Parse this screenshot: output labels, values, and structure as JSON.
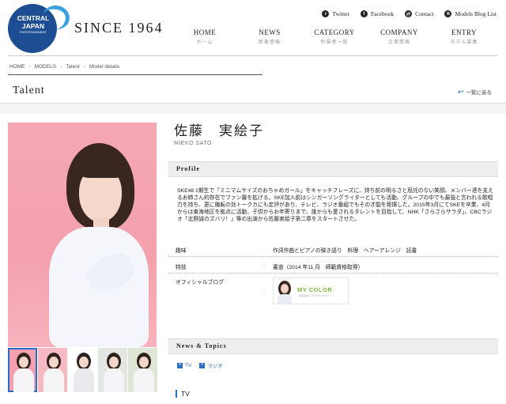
{
  "brand": {
    "logo_line1": "CENTRAL",
    "logo_line2": "JAPAN",
    "logo_line3": "ENTERTAINMENT",
    "tagline": "SINCE 1964",
    "accent": "#1d4e93"
  },
  "top_links": [
    {
      "icon": "t",
      "label": "Twitter"
    },
    {
      "icon": "f",
      "label": "Facebook"
    },
    {
      "icon": "@",
      "label": "Contact"
    },
    {
      "icon": "B",
      "label": "Models Blog List"
    }
  ],
  "nav": [
    {
      "en": "HOME",
      "jp": "ホーム"
    },
    {
      "en": "NEWS",
      "jp": "新着情報"
    },
    {
      "en": "CATEGORY",
      "jp": "所属者一覧"
    },
    {
      "en": "COMPANY",
      "jp": "企業情報"
    },
    {
      "en": "ENTRY",
      "jp": "モデル募集"
    }
  ],
  "breadcrumb": [
    "HOME",
    "MODELS",
    "Talent",
    "Model details"
  ],
  "breadcrumb_sep": "›",
  "page_title": "Talent",
  "back_link": "一覧に戻る",
  "talent": {
    "name_jp": "佐藤　実絵子",
    "name_en": "MIEKO SATO"
  },
  "profile": {
    "heading": "Profile",
    "text": "SKE48 1期生で「ミニマムサイズのおちゃめガール」をキャッチフレーズに、持ち前の明るさと屈託のない笑顔、メンバー達を支えるお姉さん的存在でファン層を拡げる。SKE加入前はシンガーソングライターとしても活動、グループの中でも最強と言われる歌唱力を持ち、更に機転の効トークカにも定評があり、テレビ、ラジオ番組でもその才能を発揮した。2015年3月にてSKEを卒業、4月からは東海地区を拠点に活動、子供からお年寄りまで、誰からも愛されるタレントを目指して、NHK「さらさらサラダ」、CBCラジオ「北野誠のズバリ！」等の出演から佐藤実絵子第二章をスタートさせた。",
    "hobby_label": "趣味",
    "hobby_value": "作詞作曲とピアノの弾き語り　料理　ヘアーアレンジ　読書",
    "skill_label": "特技",
    "skill_value": "書道（2014 年11 月　師範資格取得）",
    "blog_label": "オフィシャルブログ",
    "blog_logo": "MY COLOR",
    "blog_sub": "佐藤実絵子 OFFICIAL BLOG",
    "colon": ":"
  },
  "news": {
    "heading": "News & Topics",
    "categories": [
      "TV",
      "ラジオ"
    ],
    "first_section": "TV"
  }
}
